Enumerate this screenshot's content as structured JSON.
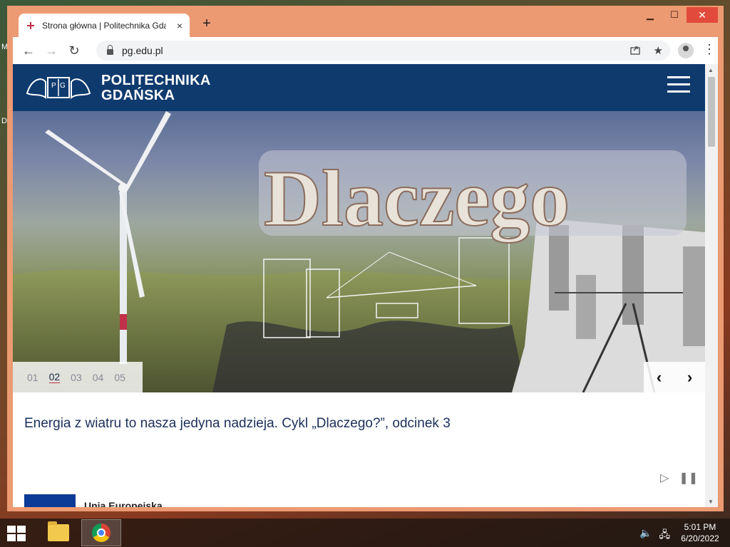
{
  "desktop": {
    "letters": [
      "M",
      "D"
    ]
  },
  "window": {
    "controls": {
      "minimize": "▁",
      "maximize": "☐",
      "close": "✕"
    }
  },
  "tab": {
    "title": "Strona główna | Politechnika Gdańska",
    "close": "×"
  },
  "new_tab": "+",
  "toolbar": {
    "back": "←",
    "forward": "→",
    "reload": "↻",
    "url": "pg.edu.pl",
    "share_icon": "share-icon",
    "bookmark_icon": "★",
    "menu": "⋮"
  },
  "site": {
    "logo_line1": "POLITECHNIKA",
    "logo_line2": "GDAŃSKA",
    "brand_color": "#0f3a6e",
    "hero_text": "Dlaczego",
    "slides": [
      "01",
      "02",
      "03",
      "04",
      "05"
    ],
    "active_slide": "02",
    "prev": "‹",
    "next": "›",
    "caption": "Energia z wiatru to nasza jedyna nadzieja. Cykl „Dlaczego?”, odcinek 3",
    "play": "▷",
    "pause": "❚❚",
    "eu_text": "Unia Europejska"
  },
  "taskbar": {
    "time": "5:01 PM",
    "date": "6/20/2022"
  }
}
